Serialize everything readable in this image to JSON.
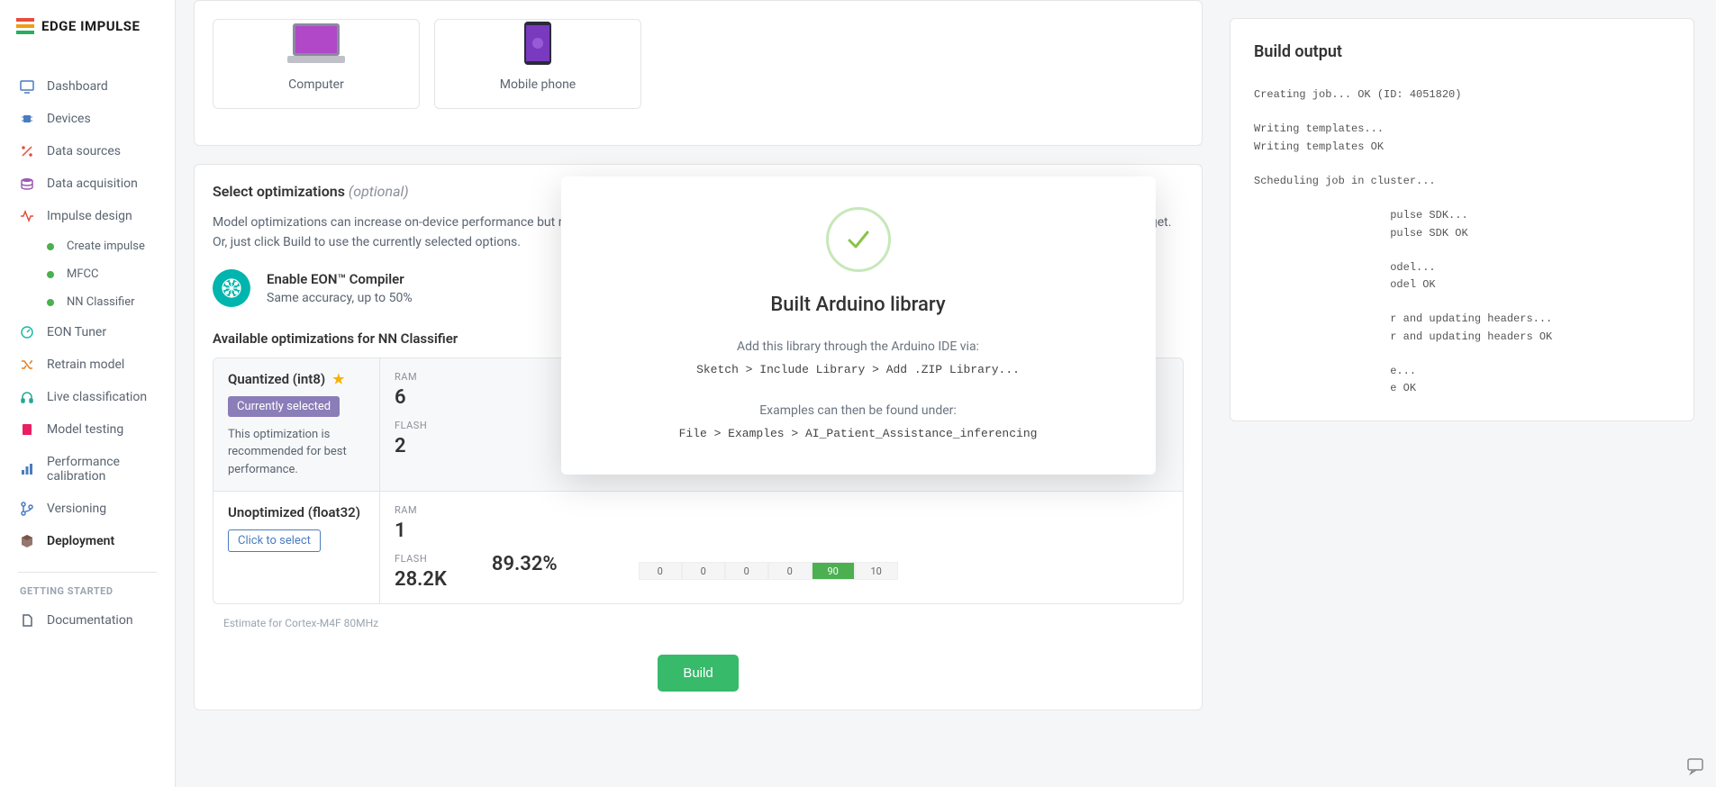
{
  "logo_text": "EDGE IMPULSE",
  "sidebar": {
    "items": [
      {
        "label": "Dashboard"
      },
      {
        "label": "Devices"
      },
      {
        "label": "Data sources"
      },
      {
        "label": "Data acquisition"
      },
      {
        "label": "Impulse design"
      },
      {
        "label": "EON Tuner"
      },
      {
        "label": "Retrain model"
      },
      {
        "label": "Live classification"
      },
      {
        "label": "Model testing"
      },
      {
        "label": "Performance calibration"
      },
      {
        "label": "Versioning"
      },
      {
        "label": "Deployment"
      }
    ],
    "sub": [
      {
        "label": "Create impulse"
      },
      {
        "label": "MFCC"
      },
      {
        "label": "NN Classifier"
      }
    ],
    "section_label": "GETTING STARTED",
    "docs": "Documentation"
  },
  "targets": [
    {
      "label": "Computer"
    },
    {
      "label": "Mobile phone"
    }
  ],
  "opt": {
    "title": "Select optimizations",
    "optional": "(optional)",
    "desc": "Model optimizations can increase on-device performance but may reduce accuracy. Click below to analyze optimizations and see the recommended choices for your target. Or, just click Build to use the currently selected options.",
    "eon_title": "Enable EON™ Compiler",
    "eon_sub": "Same accuracy, up to 50%",
    "avail_title": "Available optimizations for NN Classifier",
    "q_name": "Quantized (int8)",
    "q_selected": "Currently selected",
    "q_rec": "This optimization is recommended for best performance.",
    "u_name": "Unoptimized (float32)",
    "u_click": "Click to select",
    "ram_lbl": "RAM",
    "flash_lbl": "FLASH",
    "q_ram": "6",
    "q_flash": "2",
    "u_ram": "1",
    "u_flash": "28.2K",
    "u_acc": "89.32%",
    "conf": [
      "0",
      "0",
      "0",
      "0",
      "90",
      "10"
    ],
    "estimate": "Estimate for Cortex-M4F 80MHz",
    "build_btn": "Build"
  },
  "right": {
    "title": "Build output",
    "log": "Creating job... OK (ID: 4051820)\n\nWriting templates...\nWriting templates OK\n\nScheduling job in cluster...\n\n                     pulse SDK...\n                     pulse SDK OK\n\n                     odel...\n                     odel OK\n\n                     r and updating headers...\n                     r and updating headers OK\n\n                     e...\n                     e OK"
  },
  "modal": {
    "title": "Built Arduino library",
    "line1": "Add this library through the Arduino IDE via:",
    "code1": "Sketch > Include Library > Add .ZIP Library...",
    "line2": "Examples can then be found under:",
    "code2": "File > Examples > AI_Patient_Assistance_inferencing"
  }
}
